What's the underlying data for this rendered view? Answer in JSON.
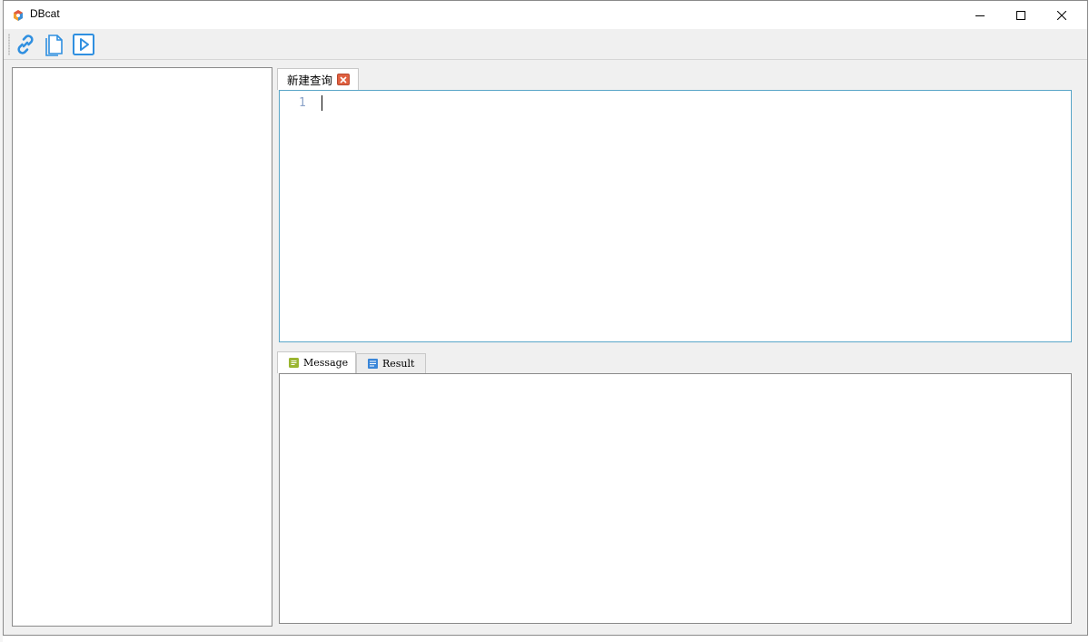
{
  "window": {
    "title": "DBcat"
  },
  "toolbar": {
    "buttons": [
      {
        "icon": "link-icon"
      },
      {
        "icon": "new-file-icon"
      },
      {
        "icon": "run-icon"
      }
    ]
  },
  "query_tabs": [
    {
      "label": "新建查询",
      "active": true
    }
  ],
  "editor": {
    "line_numbers": [
      "1"
    ],
    "content": ""
  },
  "bottom_tabs": [
    {
      "label": "Message",
      "icon": "message-icon",
      "active": true
    },
    {
      "label": "Result",
      "icon": "result-icon",
      "active": false
    }
  ],
  "colors": {
    "accent_blue": "#2f8fe0",
    "editor_border": "#5aa6c8",
    "tab_close": "#e06040",
    "message_icon": "#9ab530"
  }
}
